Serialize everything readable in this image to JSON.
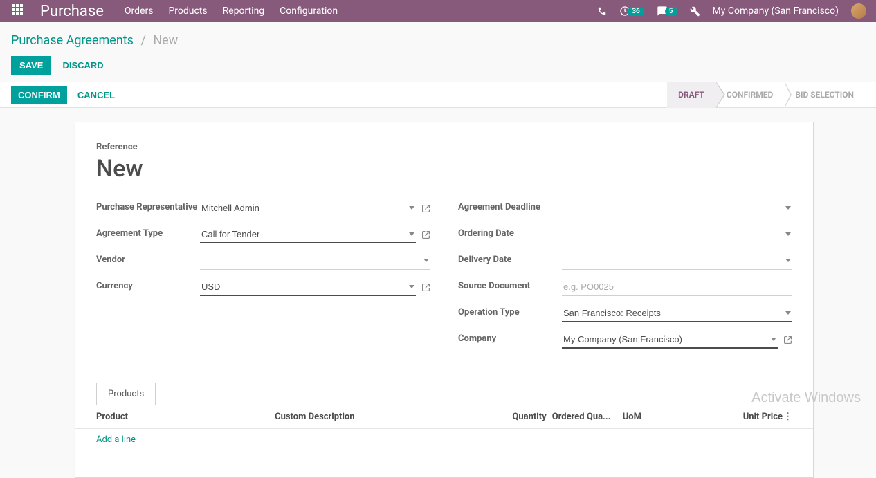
{
  "topbar": {
    "brand": "Purchase",
    "menu": [
      "Orders",
      "Products",
      "Reporting",
      "Configuration"
    ],
    "activity_count": "36",
    "message_count": "5",
    "company": "My Company (San Francisco)"
  },
  "breadcrumb": {
    "parent": "Purchase Agreements",
    "current": "New"
  },
  "actions": {
    "save": "SAVE",
    "discard": "DISCARD"
  },
  "statusbar": {
    "confirm": "CONFIRM",
    "cancel": "CANCEL",
    "stages": [
      "DRAFT",
      "CONFIRMED",
      "BID SELECTION"
    ]
  },
  "form": {
    "reference_label": "Reference",
    "reference_value": "New",
    "left": {
      "rep_label": "Purchase Representative",
      "rep_value": "Mitchell Admin",
      "type_label": "Agreement Type",
      "type_value": "Call for Tender",
      "vendor_label": "Vendor",
      "vendor_value": "",
      "currency_label": "Currency",
      "currency_value": "USD"
    },
    "right": {
      "deadline_label": "Agreement Deadline",
      "ordering_label": "Ordering Date",
      "delivery_label": "Delivery Date",
      "source_label": "Source Document",
      "source_placeholder": "e.g. PO0025",
      "optype_label": "Operation Type",
      "optype_value": "San Francisco: Receipts",
      "company_label": "Company",
      "company_value": "My Company (San Francisco)"
    }
  },
  "tabs": {
    "products": "Products"
  },
  "table": {
    "headers": {
      "product": "Product",
      "desc": "Custom Description",
      "qty": "Quantity",
      "oqty": "Ordered Qua...",
      "uom": "UoM",
      "price": "Unit Price"
    },
    "add_line": "Add a line"
  },
  "watermark": "Activate Windows"
}
